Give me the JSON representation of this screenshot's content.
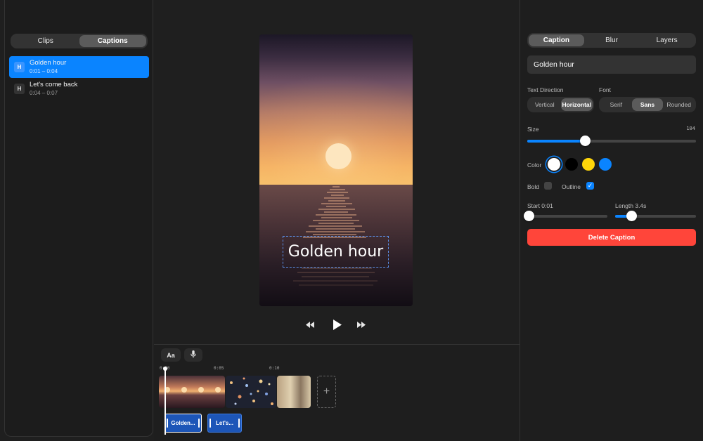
{
  "left_panel": {
    "tabs": [
      {
        "label": "Clips",
        "active": false
      },
      {
        "label": "Captions",
        "active": true
      }
    ],
    "captions": [
      {
        "icon": "H",
        "title": "Golden hour",
        "time": "0:01 – 0:04",
        "selected": true
      },
      {
        "icon": "H",
        "title": "Let's come back",
        "time": "0:04 – 0:07",
        "selected": false
      }
    ]
  },
  "preview": {
    "caption_text": "Golden hour"
  },
  "playback": {
    "rewind_icon": "rewind-icon",
    "play_icon": "play-icon",
    "forward_icon": "fast-forward-icon"
  },
  "timeline": {
    "text_button": "Aa",
    "mic_icon": "microphone-icon",
    "ticks": [
      "0:00",
      "0:05",
      "0:10"
    ],
    "add_icon": "plus-icon",
    "caption_clips": [
      "Golden...",
      "Let's..."
    ]
  },
  "right_panel": {
    "tabs": [
      {
        "label": "Caption",
        "active": true
      },
      {
        "label": "Blur",
        "active": false
      },
      {
        "label": "Layers",
        "active": false
      }
    ],
    "caption_text_value": "Golden hour",
    "text_direction": {
      "label": "Text Direction",
      "options": [
        "Vertical",
        "Horizontal"
      ],
      "selected": "Horizontal"
    },
    "font": {
      "label": "Font",
      "options": [
        "Serif",
        "Sans",
        "Rounded"
      ],
      "selected": "Sans"
    },
    "size": {
      "label": "Size",
      "value": "104",
      "fraction": 0.35
    },
    "color": {
      "label": "Color",
      "swatches": [
        "#ffffff",
        "#000000",
        "#ffd60a",
        "#0a84ff"
      ],
      "selected": "#ffffff"
    },
    "bold": {
      "label": "Bold",
      "checked": false
    },
    "outline": {
      "label": "Outline",
      "checked": true
    },
    "start": {
      "label": "Start 0:01",
      "fraction": 0.0
    },
    "length": {
      "label": "Length 3.4s",
      "fraction": 0.2
    },
    "delete_label": "Delete Caption"
  },
  "colors": {
    "accent": "#0a84ff",
    "danger": "#ff453a"
  }
}
